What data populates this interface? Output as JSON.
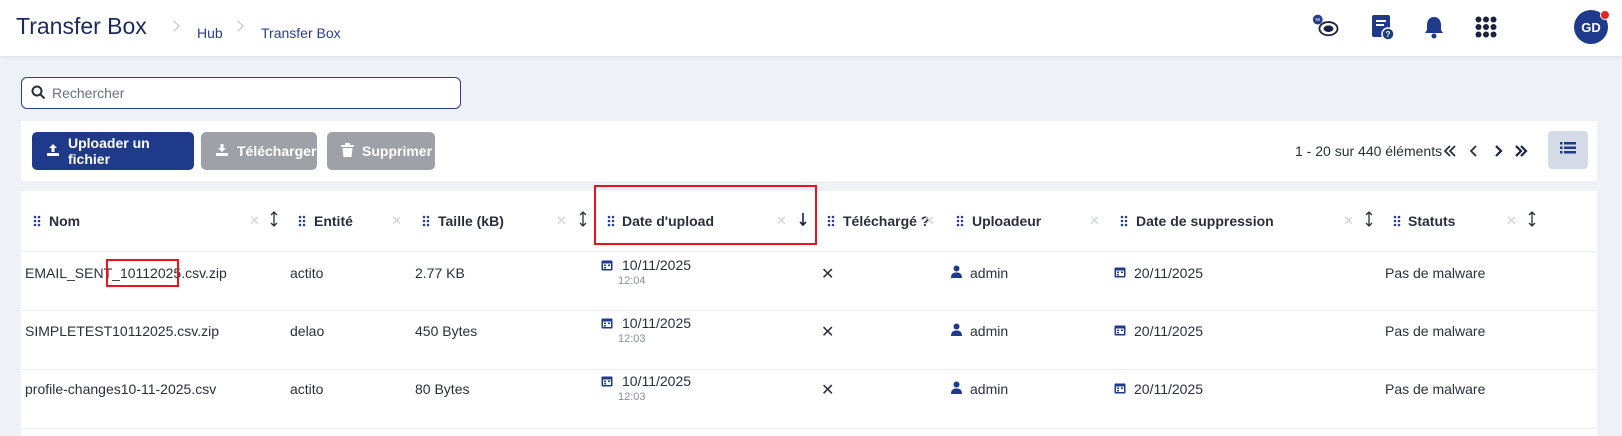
{
  "header": {
    "title": "Transfer Box",
    "breadcrumb": [
      "Hub",
      "Transfer Box"
    ]
  },
  "search": {
    "placeholder": "Rechercher",
    "value": ""
  },
  "toolbar": {
    "upload_label": "Uploader un fichier",
    "download_label": "Télécharger",
    "delete_label": "Supprimer",
    "pagination": "1 - 20 sur 440 éléments"
  },
  "table": {
    "columns": [
      "Nom",
      "Entité",
      "Taille (kB)",
      "Date d'upload",
      "Téléchargé ?",
      "Uploadeur",
      "Date de suppression",
      "Statuts"
    ],
    "sorted_column": "Date d'upload",
    "sort_direction": "descending",
    "rows": [
      {
        "name_prefix": "EMAIL_SENT_",
        "name_highlight": "10112025",
        "name_suffix": ".csv.zip",
        "entity": "actito",
        "size": "2.77 KB",
        "upload_date": "10/11/2025",
        "upload_time": "12:04",
        "downloaded": "✕",
        "uploader": "admin",
        "delete_date": "20/11/2025",
        "status": "Pas de malware"
      },
      {
        "name_prefix": "SIMPLETEST10112025.csv.zip",
        "name_highlight": "",
        "name_suffix": "",
        "entity": "delao",
        "size": "450 Bytes",
        "upload_date": "10/11/2025",
        "upload_time": "12:03",
        "downloaded": "✕",
        "uploader": "admin",
        "delete_date": "20/11/2025",
        "status": "Pas de malware"
      },
      {
        "name_prefix": "profile-changes10-11-2025.csv",
        "name_highlight": "",
        "name_suffix": "",
        "entity": "actito",
        "size": "80 Bytes",
        "upload_date": "10/11/2025",
        "upload_time": "12:03",
        "downloaded": "✕",
        "uploader": "admin",
        "delete_date": "20/11/2025",
        "status": "Pas de malware"
      }
    ]
  },
  "user": {
    "initials": "GD"
  },
  "colors": {
    "primary": "#1f3a8a",
    "highlight": "#e8141b",
    "disabled": "#9ea2a8"
  },
  "icons": [
    "hub-logo-icon",
    "help-document-icon",
    "bell-icon",
    "apps-grid-icon",
    "upload-icon",
    "download-icon",
    "trash-icon",
    "calendar-icon",
    "user-icon",
    "close-icon",
    "list-view-icon"
  ]
}
